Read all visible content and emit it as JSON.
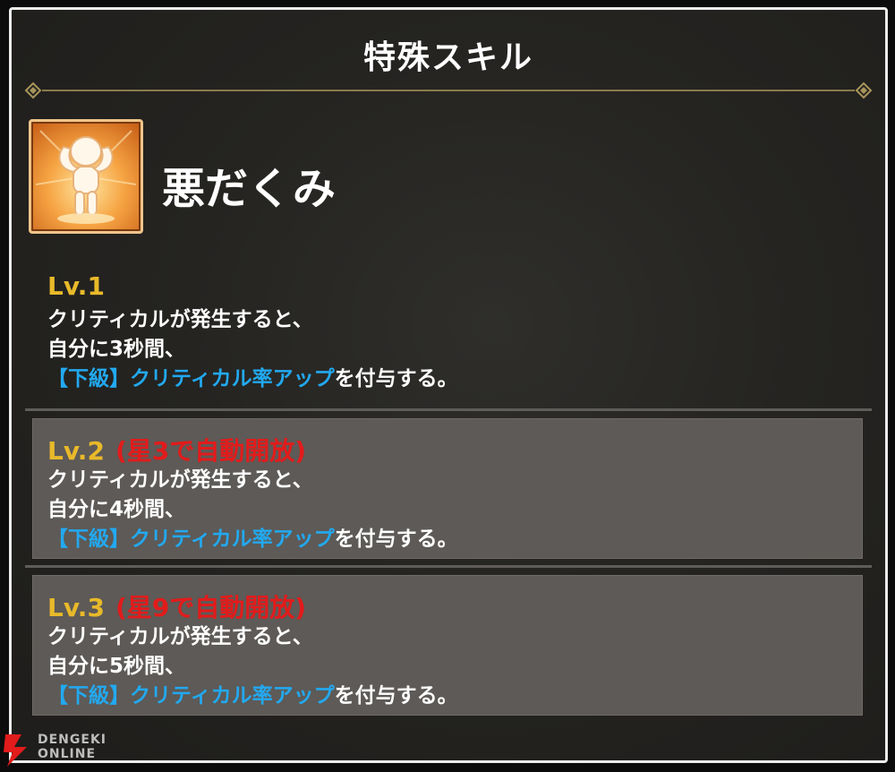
{
  "title": "特殊スキル",
  "skill": {
    "name": "悪だくみ",
    "icon": "flexing-character-icon"
  },
  "levels": [
    {
      "label": "Lv.1",
      "unlock": "",
      "lines": [
        "クリティカルが発生すると、",
        "自分に3秒間、"
      ],
      "effect_link": "【下級】クリティカル率アップ",
      "effect_suffix": "を付与する。"
    },
    {
      "label": "Lv.2",
      "unlock": "(星3で自動開放)",
      "lines": [
        "クリティカルが発生すると、",
        "自分に4秒間、"
      ],
      "effect_link": "【下級】クリティカル率アップ",
      "effect_suffix": "を付与する。"
    },
    {
      "label": "Lv.3",
      "unlock": "(星9で自動開放)",
      "lines": [
        "クリティカルが発生すると、",
        "自分に5秒間、"
      ],
      "effect_link": "【下級】クリティカル率アップ",
      "effect_suffix": "を付与する。"
    }
  ],
  "watermark": {
    "line1": "DENGEKI",
    "line2": "ONLINE"
  },
  "colors": {
    "level_label": "#e8b92a",
    "unlock": "#e21b1b",
    "effect_link": "#22a9f0"
  }
}
